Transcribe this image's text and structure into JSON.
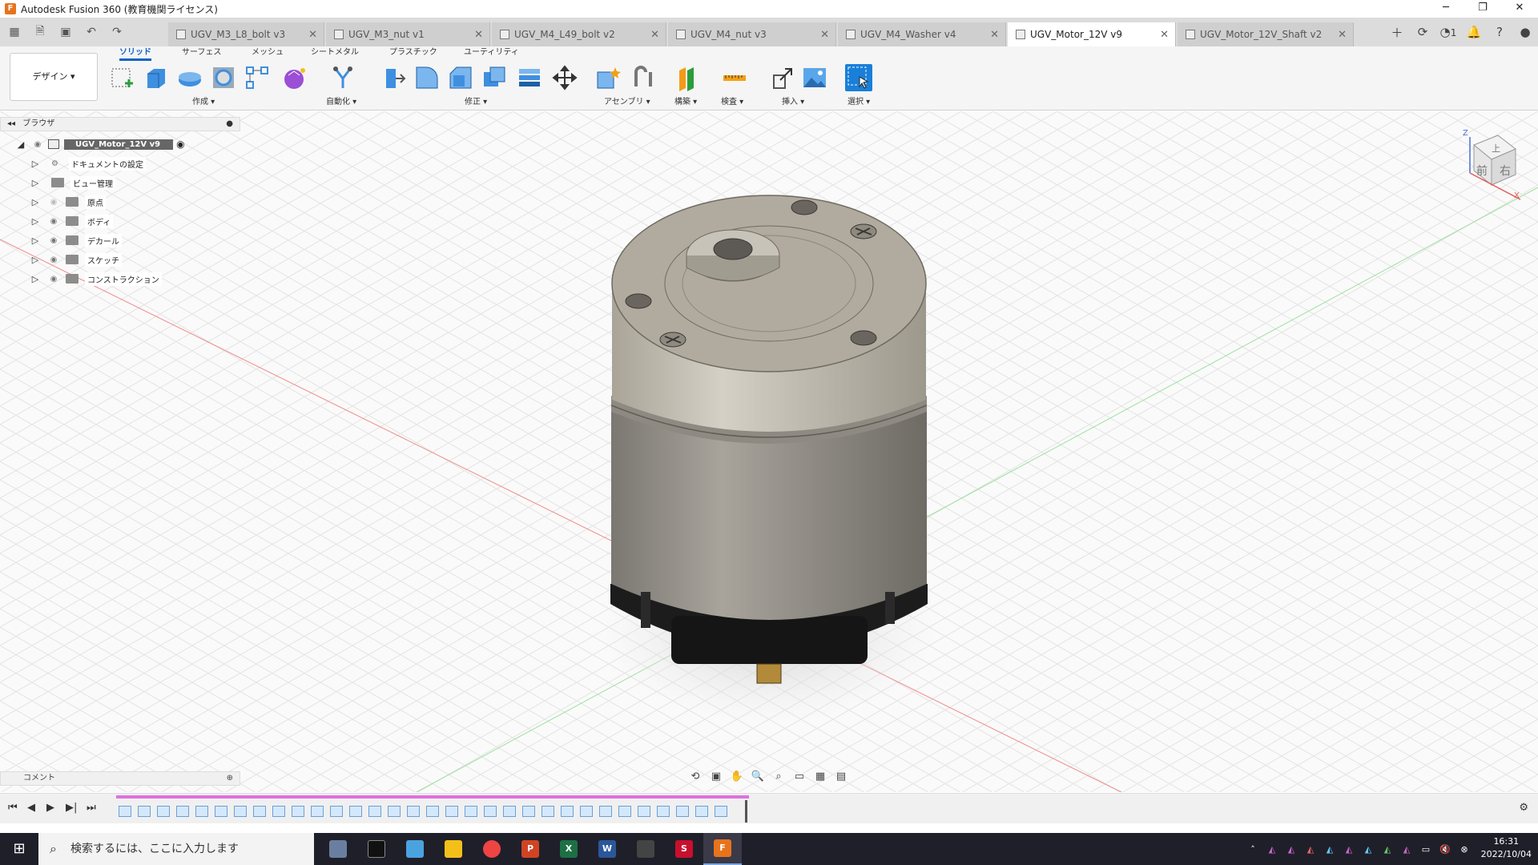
{
  "app": {
    "title": "Autodesk Fusion 360 (教育機関ライセンス)",
    "logo_icon": "fusion-logo-icon",
    "window_buttons": [
      "─",
      "❐",
      "✕"
    ]
  },
  "tabs": [
    {
      "label": "UGV_M3_L8_bolt v3",
      "active": false
    },
    {
      "label": "UGV_M3_nut v1",
      "active": false
    },
    {
      "label": "UGV_M4_L49_bolt v2",
      "active": false
    },
    {
      "label": "UGV_M4_nut v3",
      "active": false
    },
    {
      "label": "UGV_M4_Washer v4",
      "active": false
    },
    {
      "label": "UGV_Motor_12V v9",
      "active": true
    },
    {
      "label": "UGV_Motor_12V_Shaft v2",
      "active": false
    }
  ],
  "tabbar_right": {
    "notifications": "1"
  },
  "toolbar": {
    "workspace": "デザイン ▾",
    "workspace_tabs": [
      "ソリッド",
      "サーフェス",
      "メッシュ",
      "シートメタル",
      "プラスチック",
      "ユーティリティ"
    ],
    "groups": [
      "作成 ▾",
      "自動化 ▾",
      "修正 ▾",
      "アセンブリ ▾",
      "構築 ▾",
      "検査 ▾",
      "挿入 ▾",
      "選択 ▾"
    ]
  },
  "browser": {
    "title": "ブラウザ",
    "root": "UGV_Motor_12V v9",
    "items": [
      "ドキュメントの設定",
      "ビュー管理",
      "原点",
      "ボディ",
      "デカール",
      "スケッチ",
      "コンストラクション"
    ]
  },
  "viewcube": {
    "top": "上",
    "front": "前",
    "right": "右",
    "axis_z": "Z",
    "axis_x": "X"
  },
  "comments": {
    "label": "コメント"
  },
  "taskbar": {
    "search_placeholder": "検索するには、ここに入力します",
    "time": "16:31",
    "date": "2022/10/04"
  },
  "colors": {
    "accent": "#0a62c6",
    "motor_body": "#b6b0a4",
    "motor_can": "#85817a",
    "timeline_track": "#e070e0"
  }
}
